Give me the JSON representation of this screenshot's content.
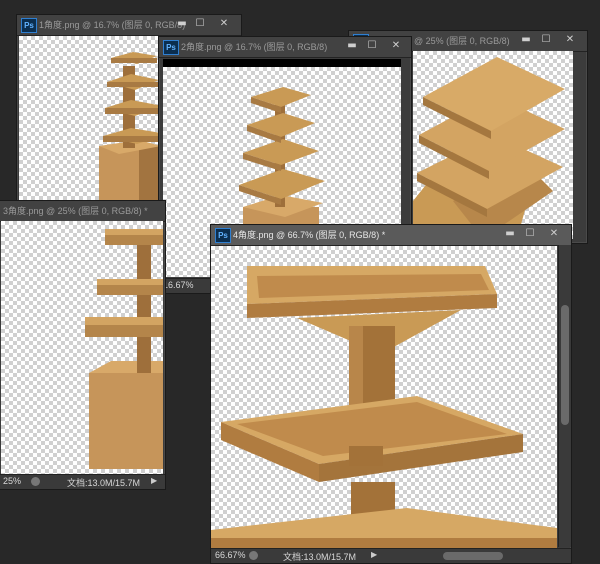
{
  "windows": {
    "w1": {
      "title": "1角度.png @ 16.7% (图层 0, RGB/8)"
    },
    "w2": {
      "title": "2角度.png @ 16.7% (图层 0, RGB/8)",
      "zoom": "16.67%"
    },
    "w3": {
      "title": "3角度.png @ 25% (图层 0, RGB/8)"
    },
    "w_left": {
      "title": "3角度.png @ 25% (图层 0, RGB/8) *",
      "zoom": "25%",
      "doc": "文档:13.0M/15.7M"
    },
    "w4": {
      "title": "4角度.png @ 66.7% (图层 0, RGB/8) *",
      "zoom": "66.67%",
      "doc": "文档:13.0M/15.7M"
    }
  },
  "controls": {
    "minimize": "▬",
    "maximize": "☐",
    "close": "✕"
  },
  "icons": {
    "app": "Ps",
    "status_arrow": "▶"
  },
  "colors": {
    "wood": "#c99a55",
    "wood_dark": "#8a6530",
    "wood_light": "#e0b977"
  }
}
